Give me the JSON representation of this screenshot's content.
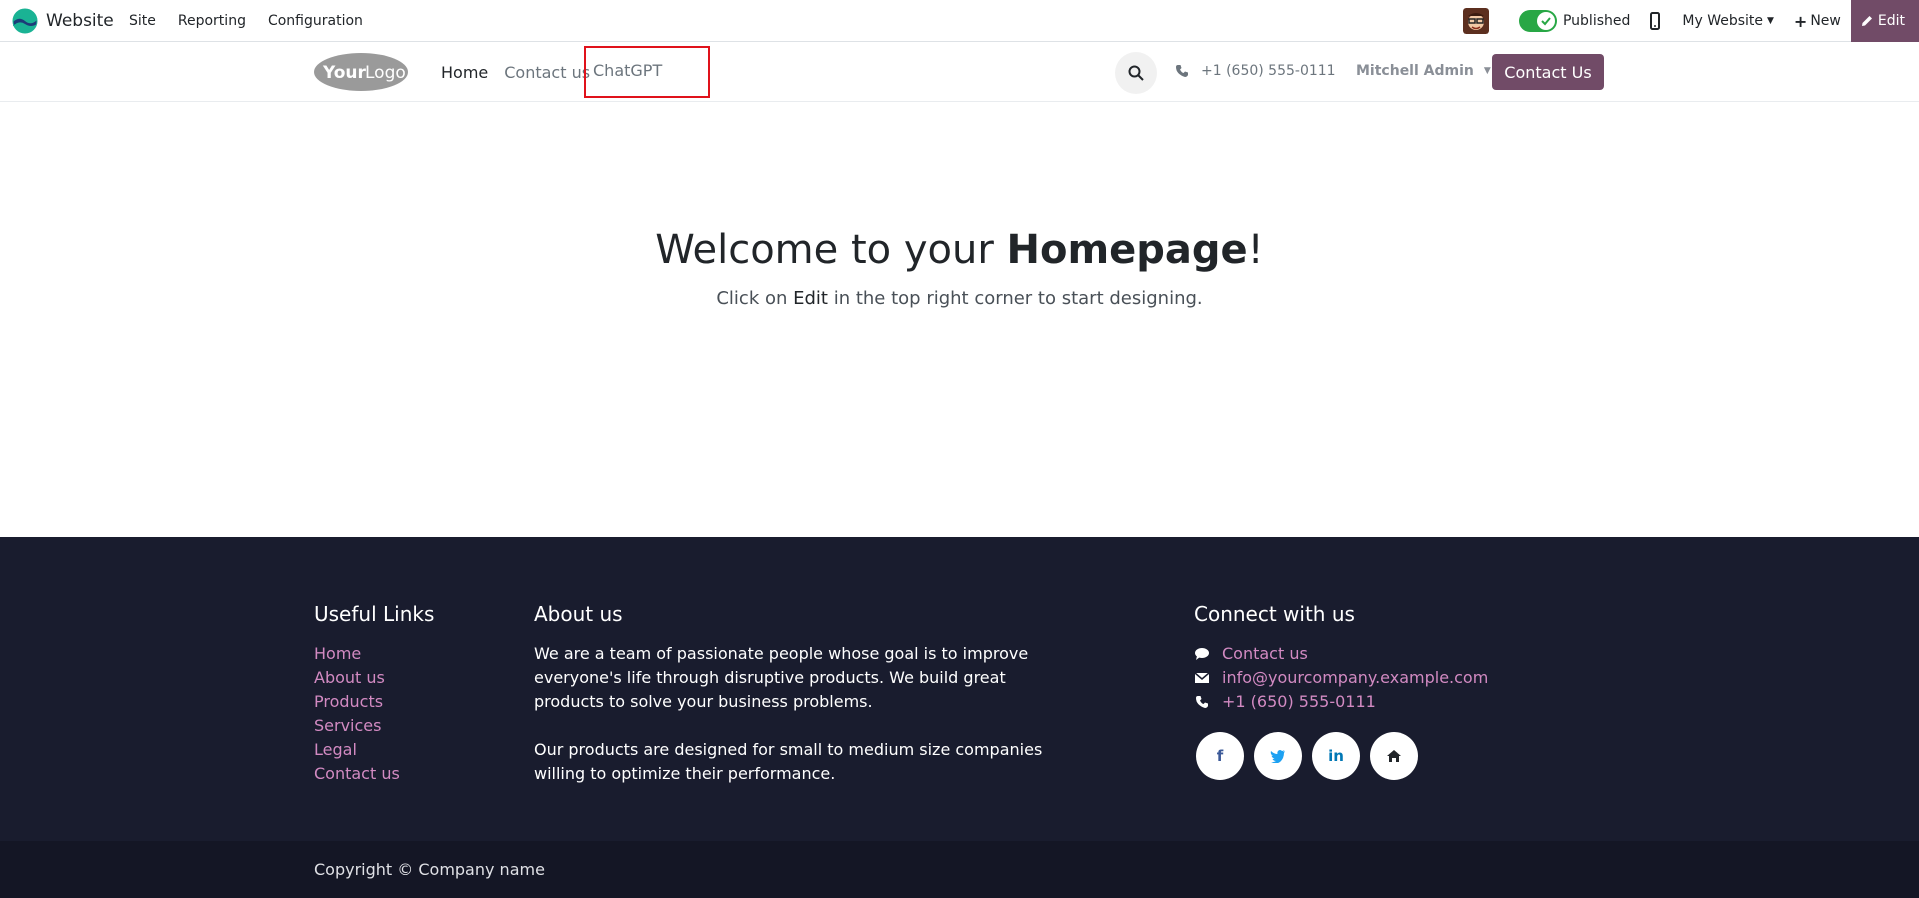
{
  "topbar": {
    "app_name": "Website",
    "menu": [
      "Site",
      "Reporting",
      "Configuration"
    ],
    "published_label": "Published",
    "website_selector": "My Website",
    "new_label": "New",
    "edit_label": "Edit"
  },
  "header": {
    "nav": [
      "Home",
      "Contact us"
    ],
    "new_menu_item": "ChatGPT",
    "phone": "+1 (650) 555-0111",
    "user": "Mitchell Admin",
    "cta": "Contact Us"
  },
  "hero": {
    "title_pre": "Welcome to your ",
    "title_bold": "Homepage",
    "title_post": "!",
    "subtitle_pre": "Click on ",
    "subtitle_bold": "Edit",
    "subtitle_post": " in the top right corner to start designing."
  },
  "footer": {
    "useful_links_title": "Useful Links",
    "useful_links": [
      "Home",
      "About us",
      "Products",
      "Services",
      "Legal",
      "Contact us"
    ],
    "about_title": "About us",
    "about_p1": "We are a team of passionate people whose goal is to improve everyone's life through disruptive products. We build great products to solve your business problems.",
    "about_p2": "Our products are designed for small to medium size companies willing to optimize their performance.",
    "connect_title": "Connect with us",
    "connect": [
      "Contact us",
      "info@yourcompany.example.com",
      "+1 (650) 555-0111"
    ],
    "copyright": "Copyright © Company name"
  },
  "colors": {
    "brand": "#714b67",
    "footer_bg": "#191c2e",
    "footer_link": "#d28ac2",
    "highlight": "#e0121b"
  }
}
